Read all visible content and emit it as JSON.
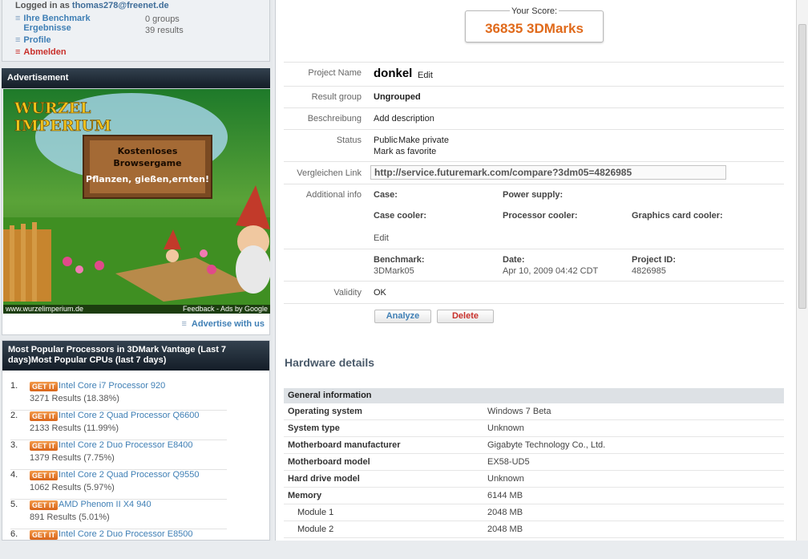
{
  "login": {
    "logged_in_label": "Logged in as",
    "email": "thomas278@freenet.de",
    "links": [
      {
        "label": "Ihre Benchmark Ergebnisse"
      },
      {
        "label": "Profile"
      },
      {
        "label": "Abmelden"
      }
    ],
    "groups": "0 groups",
    "results": "39 results"
  },
  "advertisement": {
    "title": "Advertisement",
    "ad_brand": "WURZEL IMPERIUM",
    "sign_line1": "Kostenloses",
    "sign_line2": "Browsergame",
    "sign_line3": "Pflanzen, gießen,ernten!",
    "url": "www.wurzelimperium.de",
    "feedback": "Feedback - Ads by Google",
    "advertise_link": "Advertise with us"
  },
  "popular": {
    "title": "Most Popular Processors in 3DMark Vantage (Last 7 days)Most Popular CPUs (last 7 days)",
    "badge": "GET IT",
    "items": [
      {
        "rank": "1.",
        "name": "Intel Core i7 Processor 920",
        "results": "3271 Results (18.38%)"
      },
      {
        "rank": "2.",
        "name": "Intel Core 2 Quad Processor Q6600",
        "results": "2133 Results (11.99%)"
      },
      {
        "rank": "3.",
        "name": "Intel Core 2 Duo Processor E8400",
        "results": "1379 Results (7.75%)"
      },
      {
        "rank": "4.",
        "name": "Intel Core 2 Quad Processor Q9550",
        "results": "1062 Results (5.97%)"
      },
      {
        "rank": "5.",
        "name": "AMD Phenom II X4 940",
        "results": "891 Results (5.01%)"
      },
      {
        "rank": "6.",
        "name": "Intel Core 2 Duo Processor E8500",
        "results": ""
      }
    ]
  },
  "score": {
    "label": "Your Score:",
    "value": "36835 3DMarks"
  },
  "project": {
    "name_label": "Project Name",
    "name": "donkel",
    "edit": "Edit",
    "group_label": "Result group",
    "group": "Ungrouped",
    "desc_label": "Beschreibung",
    "desc_link": "Add description",
    "status_label": "Status",
    "status": "Public",
    "make_private": "Make private",
    "mark_favorite": "Mark as favorite",
    "compare_label": "Vergleichen Link",
    "compare_url": "http://service.futuremark.com/compare?3dm05=4826985",
    "additional_label": "Additional info",
    "case_label": "Case:",
    "power_label": "Power supply:",
    "case_cooler_label": "Case cooler:",
    "proc_cooler_label": "Processor cooler:",
    "gpu_cooler_label": "Graphics card cooler:",
    "add_edit": "Edit",
    "benchmark_label": "Benchmark:",
    "benchmark": "3DMark05",
    "date_label": "Date:",
    "date": "Apr 10, 2009 04:42 CDT",
    "project_id_label": "Project ID:",
    "project_id": "4826985",
    "validity_label": "Validity",
    "validity": "OK",
    "analyze": "Analyze",
    "delete": "Delete"
  },
  "hardware": {
    "title": "Hardware details",
    "section": "General information",
    "rows": [
      {
        "k": "Operating system",
        "v": "Windows 7 Beta"
      },
      {
        "k": "System type",
        "v": "Unknown"
      },
      {
        "k": "Motherboard manufacturer",
        "v": "Gigabyte Technology Co., Ltd."
      },
      {
        "k": "Motherboard model",
        "v": "EX58-UD5"
      },
      {
        "k": "Hard drive model",
        "v": "Unknown"
      },
      {
        "k": "Memory",
        "v": "6144 MB"
      },
      {
        "k": "Module 1",
        "v": "2048 MB"
      },
      {
        "k": "Module 2",
        "v": "2048 MB"
      }
    ]
  }
}
